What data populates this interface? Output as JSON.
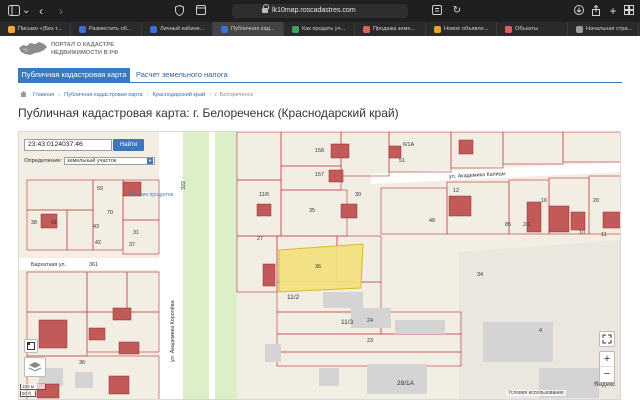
{
  "browser": {
    "url": "lk10map.roscadastres.com",
    "tabs": [
      {
        "label": "Письмо «(Без т...",
        "color": "#f4a640",
        "active": false
      },
      {
        "label": "Разместить об...",
        "color": "#3b6fd6",
        "active": false
      },
      {
        "label": "Личный кабине...",
        "color": "#3b6fd6",
        "active": false
      },
      {
        "label": "Публичная кад...",
        "color": "#3b6fd6",
        "active": true
      },
      {
        "label": "Как продать уч...",
        "color": "#3ba55c",
        "active": false
      },
      {
        "label": "Продажа земе...",
        "color": "#e35b5b",
        "active": false
      },
      {
        "label": "Новое объявле...",
        "color": "#e8a030",
        "active": false
      },
      {
        "label": "Объекты",
        "color": "#e35b5b",
        "active": false
      },
      {
        "label": "Начальная стра...",
        "color": "#9a9a9a",
        "active": false
      }
    ]
  },
  "site": {
    "logo_text": "Портал о кадастре недвижимости в РФ",
    "nav": {
      "active_tab": "Публичная кадастровая карта",
      "second_tab": "Расчет земельного налога"
    },
    "breadcrumbs": [
      "Главная",
      "Публичная кадастровая карта",
      "Краснодарский край",
      "г. Белореченск"
    ],
    "page_title": "Публичная кадастровая карта: г. Белореченск (Краснодарский край)"
  },
  "map": {
    "search": {
      "value": "23:43:0124037:46",
      "button": "Найти"
    },
    "definition": {
      "label": "Определение:",
      "selected": "земельный участок"
    },
    "scale": {
      "top": "100 м",
      "bottom": "50 ft"
    },
    "attribution": "Яндекс",
    "terms": "Условия использования",
    "zoom_in": "+",
    "zoom_out": "−",
    "streets": [
      "ул. Академика Королёва",
      "Бархатная ул.",
      "ул. Академика Капицы"
    ],
    "poi": [
      "Магазин продуктов"
    ],
    "parcel_labels": [
      "158",
      "157",
      "30",
      "11/6",
      "12",
      "35",
      "27",
      "36",
      "11/2",
      "11/3",
      "24",
      "23",
      "28/1А",
      "34",
      "38",
      "41",
      "43",
      "42",
      "31",
      "37",
      "59",
      "70",
      "361",
      "322",
      "96",
      "85",
      "51",
      "16",
      "20",
      "48",
      "401",
      "8",
      "1/1",
      "6/1А",
      "85",
      "2/1",
      "10",
      "11",
      "36",
      "4",
      "33"
    ],
    "highlighted_parcel": "36"
  }
}
